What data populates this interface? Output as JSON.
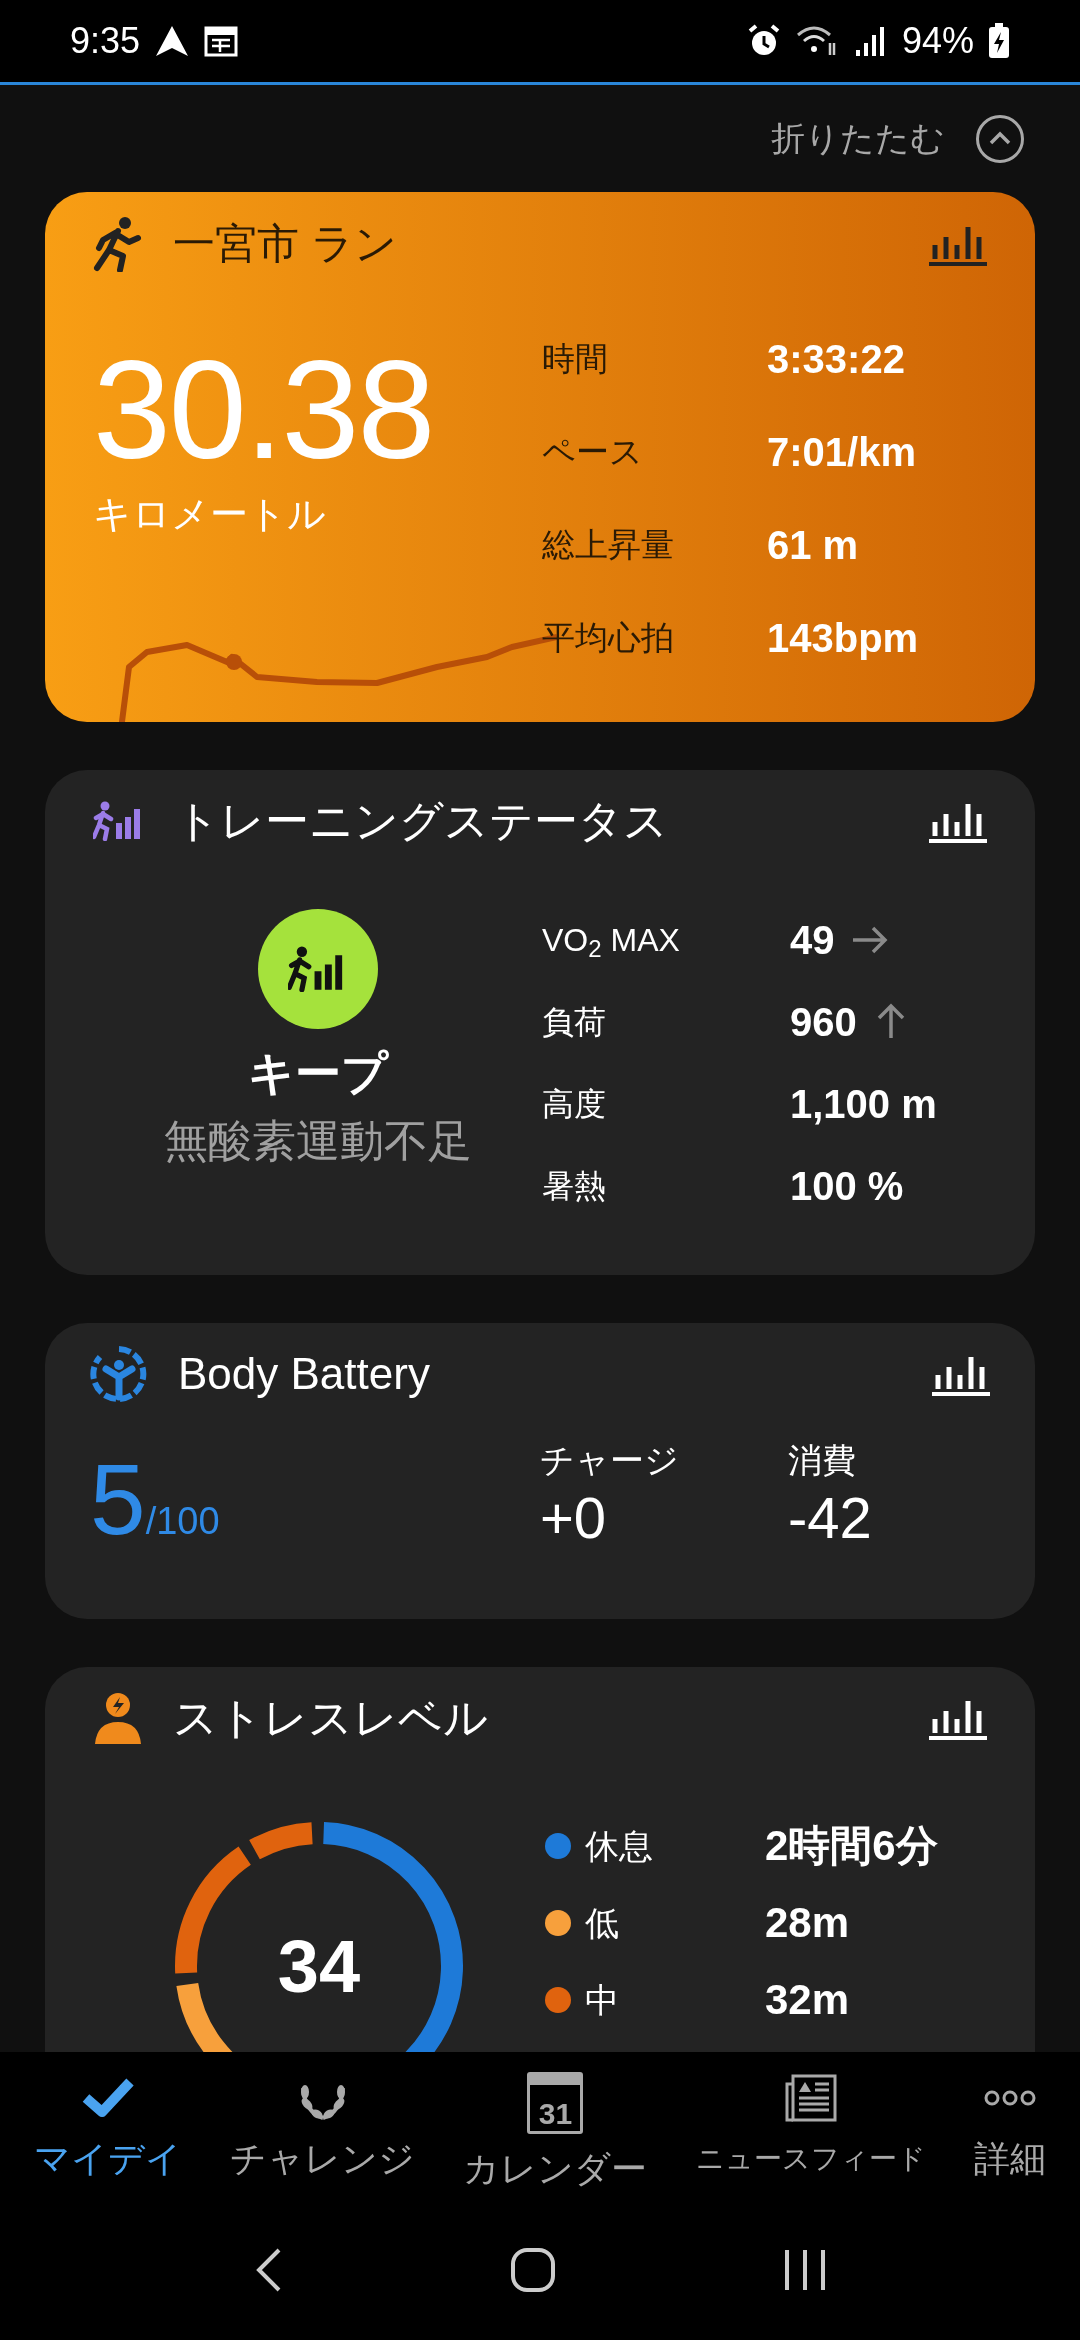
{
  "status_bar": {
    "time": "9:35",
    "battery": "94%"
  },
  "collapse": {
    "label": "折りたたむ"
  },
  "run_card": {
    "title": "一宮市 ラン",
    "distance": "30.38",
    "unit": "キロメートル",
    "stats": [
      {
        "label": "時間",
        "value": "3:33:22"
      },
      {
        "label": "ペース",
        "value": "7:01/km"
      },
      {
        "label": "総上昇量",
        "value": "61 m"
      },
      {
        "label": "平均心拍",
        "value": "143bpm"
      }
    ]
  },
  "training_status": {
    "title": "トレーニングステータス",
    "status": "キープ",
    "feedback": "無酸素運動不足",
    "stats": [
      {
        "label": "VO$_{2}$ MAX",
        "value": "49",
        "kind": "steady"
      },
      {
        "label": "負荷",
        "value": "960",
        "kind": "rising"
      },
      {
        "label": "高度",
        "value": "1,100 m",
        "kind": "plain"
      },
      {
        "label": "暑熱",
        "value": "100 %",
        "kind": "plain"
      }
    ]
  },
  "body_battery": {
    "title": "Body Battery",
    "value": "5",
    "max": "/100",
    "charged_label": "チャージ",
    "charged": "+0",
    "drained_label": "消費",
    "drained": "-42"
  },
  "stress": {
    "title": "ストレスレベル",
    "value": "34",
    "legend": [
      {
        "label": "休息",
        "value": "2時間6分",
        "color": "#1e7ad8"
      },
      {
        "label": "低",
        "value": "28m",
        "color": "#f7a03c"
      },
      {
        "label": "中",
        "value": "32m",
        "color": "#e0630e"
      }
    ]
  },
  "bottom_nav": [
    {
      "label": "マイデイ",
      "selected": true
    },
    {
      "label": "チャレンジ",
      "selected": false
    },
    {
      "label": "カレンダー",
      "icon_text": "31",
      "selected": false
    },
    {
      "label": "ニュースフィード",
      "selected": false
    },
    {
      "label": "詳細",
      "selected": false
    }
  ]
}
